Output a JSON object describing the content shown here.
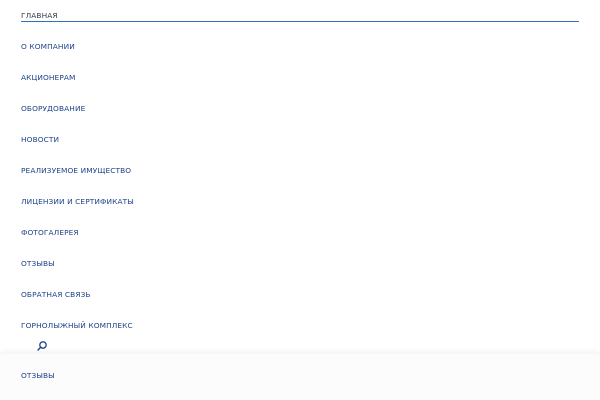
{
  "menu": {
    "items": [
      {
        "label": "ГЛАВНАЯ"
      },
      {
        "label": "О КОМПАНИИ"
      },
      {
        "label": "АКЦИОНЕРАМ"
      },
      {
        "label": "ОБОРУДОВАНИЕ"
      },
      {
        "label": "НОВОСТИ"
      },
      {
        "label": "РЕАЛИЗУЕМОЕ ИМУЩЕСТВО"
      },
      {
        "label": "ЛИЦЕНЗИИ И СЕРТИФИКАТЫ"
      },
      {
        "label": "ФОТОГАЛЕРЕЯ"
      },
      {
        "label": "ОТЗЫВЫ"
      },
      {
        "label": "ОБРАТНАЯ СВЯЗЬ"
      },
      {
        "label": "ГОРНОЛЫЖНЫЙ КОМПЛЕКС"
      }
    ],
    "active_color": "#333a47",
    "link_color": "#20448a",
    "underline_color": "#2f6fbe"
  },
  "search": {
    "icon": "search-icon"
  },
  "bottom_bar": {
    "item_label": "ОТЗЫВЫ"
  }
}
